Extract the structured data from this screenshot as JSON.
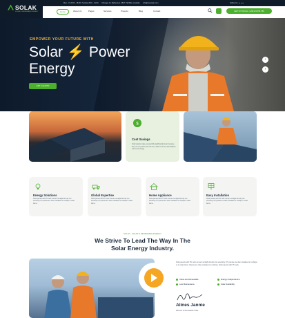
{
  "brand": {
    "name": "SOLAK",
    "tagline": "SOLAR & RENEWABLE ENERGY",
    "accent": "#4caf2e",
    "dark": "#101b2a",
    "orange": "#f5a623"
  },
  "topbar": {
    "info": [
      "Mon - Fri 8:00 - 18:00 / Sunday 8:00 - 14:00",
      "Chicago 12, Melbourne, 3847 YEONE, Australia",
      "info@example.com"
    ],
    "social_label": "Follow Us :"
  },
  "nav": {
    "items": [
      "Home",
      "About Us",
      "Pages",
      "Services",
      "Projects",
      "Blog",
      "Contact"
    ],
    "cta": "GET IN TOUCH: (+00)123 456 789"
  },
  "hero": {
    "eyebrow": "EMPOWER YOUR FUTURE WITH",
    "title_line1_a": "Solar",
    "title_bolt": "⚡",
    "title_line1_b": "Power",
    "title_line2": "Energy",
    "button": "GET A QUOTE"
  },
  "cost_card": {
    "title": "Cost Savings",
    "text": "Solar panels make energy bills significantly lower because they run on power from the sun, which is a free and limitless source of energy."
  },
  "features": [
    {
      "title": "Energy Solutions",
      "icon": "bulb-icon",
      "text": "Solar panels with PV cells convert sunlight directly into electricity. PV panels are often installed on rooftops in solar farms."
    },
    {
      "title": "Global Expertise",
      "icon": "truck-icon",
      "text": "Solar panels with PV cells convert sunlight directly into electricity. PV panels are often installed on rooftops in solar farms."
    },
    {
      "title": "Home Appliance",
      "icon": "house-icon",
      "text": "Solar panels with PV cells convert sunlight directly into electricity. PV panels are often installed on rooftops in solar farms."
    },
    {
      "title": "Easy Installation",
      "icon": "panel-icon",
      "text": "Solar panels with PV cells convert sunlight directly into electricity. PV panels are often installed on rooftops in solar farms."
    }
  ],
  "section": {
    "eyebrow": "SOLAK - SOLAR & RENEWABLE ENERGY",
    "title_line1": "We Strive To Lead The Way In The",
    "title_line2": "Solar Energy Industry."
  },
  "about": {
    "text": "Solar panels with PV cells convert sunlight directly into electricity. PV panels are often installed on rooftops or in solar farms. Panels are often installed on rooftops. Solar panels with PV cells.",
    "checks": [
      "Clean and Renewable",
      "Energy Independence",
      "Low Maintenance",
      "Solar Scalability"
    ],
    "name": "Alines Jannie",
    "role": "Director of Renewable Solar"
  }
}
